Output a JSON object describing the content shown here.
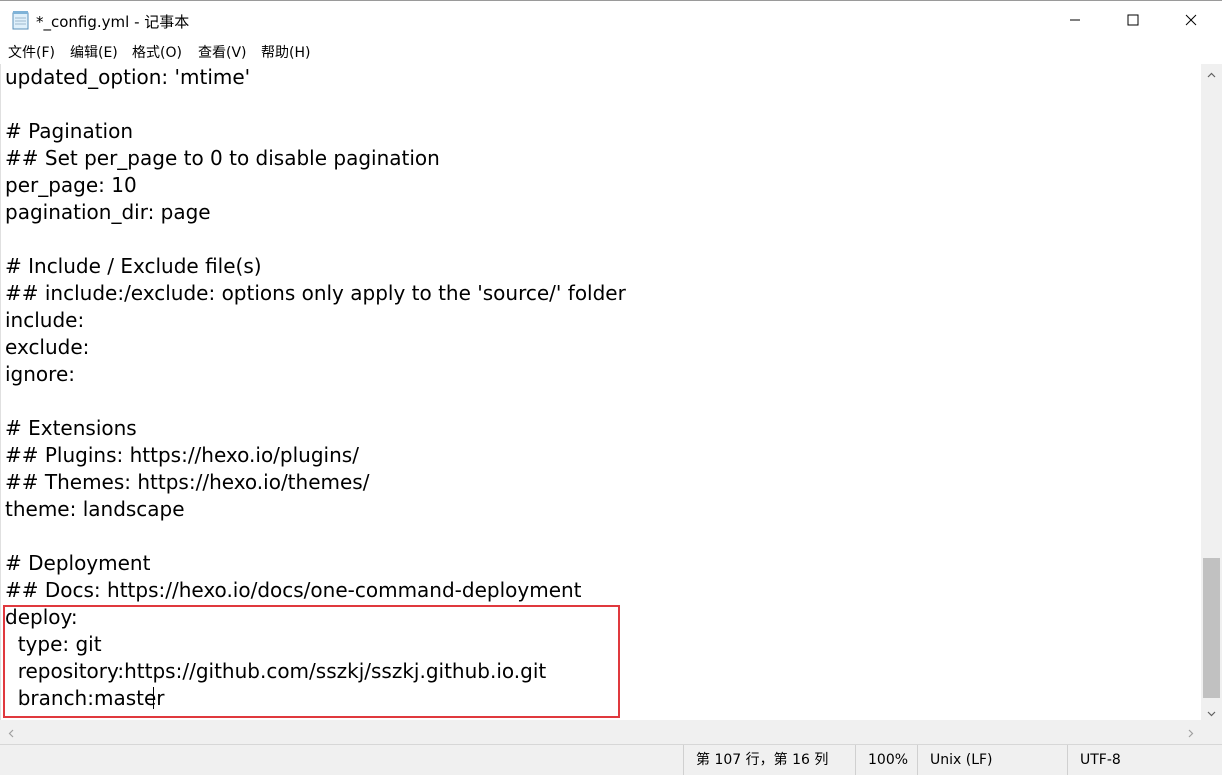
{
  "window": {
    "title": "*_config.yml - 记事本",
    "icon": "notepad-icon",
    "controls": [
      "minimize-icon",
      "maximize-icon",
      "close-icon"
    ]
  },
  "menu": [
    {
      "label": "文件(F)"
    },
    {
      "label": "编辑(E)"
    },
    {
      "label": "格式(O)"
    },
    {
      "label": "查看(V)"
    },
    {
      "label": "帮助(H)"
    }
  ],
  "editor": {
    "lines": [
      "updated_option: 'mtime'",
      "",
      "# Pagination",
      "## Set per_page to 0 to disable pagination",
      "per_page: 10",
      "pagination_dir: page",
      "",
      "# Include / Exclude file(s)",
      "## include:/exclude: options only apply to the 'source/' folder",
      "include:",
      "exclude:",
      "ignore:",
      "",
      "# Extensions",
      "## Plugins: https://hexo.io/plugins/",
      "## Themes: https://hexo.io/themes/",
      "theme: landscape",
      "",
      "# Deployment",
      "## Docs: https://hexo.io/docs/one-command-deployment",
      "deploy:",
      "  type: git",
      "  repository:https://github.com/sszkj/sszkj.github.io.git",
      "  branch:master"
    ],
    "highlight_color": "#e0393e"
  },
  "status": {
    "position": "第 107 行，第 16 列",
    "zoom": "100%",
    "line_ending": "Unix (LF)",
    "encoding": "UTF-8"
  }
}
